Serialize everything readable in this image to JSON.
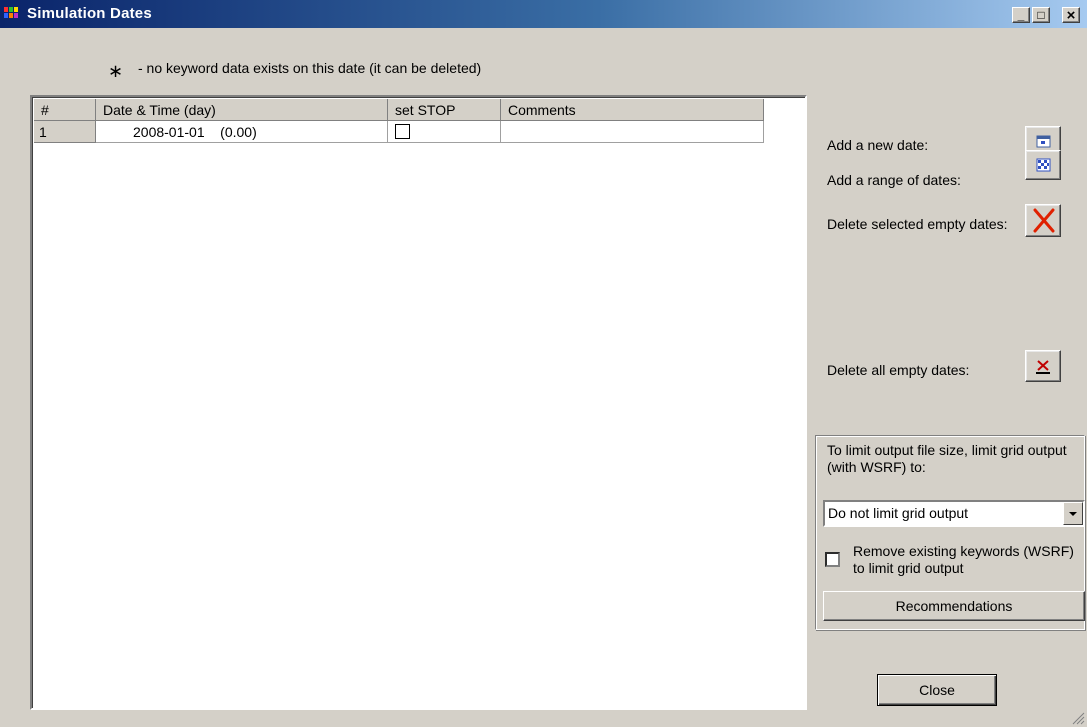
{
  "window": {
    "title": "Simulation Dates",
    "minimize_label": "_",
    "maximize_label": "□",
    "close_label": "×"
  },
  "legend": {
    "symbol": "∗",
    "text": "- no keyword data exists on this date (it can be deleted)"
  },
  "grid": {
    "columns": [
      "#",
      "Date & Time (day)",
      "set STOP",
      "Comments"
    ],
    "rows": [
      {
        "num": "1",
        "date": "2008-01-01    (0.00)",
        "set_stop": false,
        "comments": ""
      }
    ]
  },
  "actions": {
    "add_date_label": "Add a new date:",
    "add_range_label": "Add a range of dates:",
    "delete_selected_label": "Delete selected empty dates:",
    "delete_all_label": "Delete all empty dates:"
  },
  "output_limit": {
    "description": "To limit output file size, limit grid output (with WSRF) to:",
    "selected_option": "Do not limit grid output",
    "remove_keywords_label": "Remove existing keywords (WSRF) to limit grid output",
    "remove_keywords_checked": false,
    "recommendations_label": "Recommendations"
  },
  "footer": {
    "close_label": "Close"
  }
}
